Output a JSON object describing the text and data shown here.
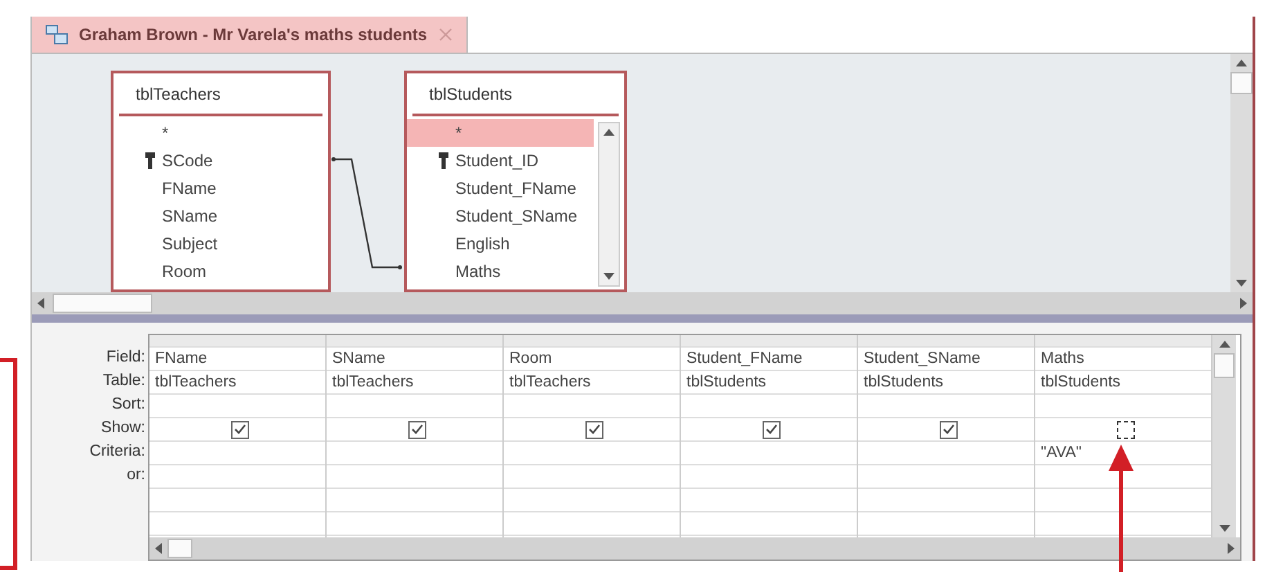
{
  "tab": {
    "title": "Graham Brown - Mr Varela's maths students",
    "selected": true
  },
  "tables": [
    {
      "name": "tblTeachers",
      "scrollable": false,
      "fields": [
        {
          "name": "*",
          "key": false,
          "selected": false
        },
        {
          "name": "SCode",
          "key": true,
          "selected": false
        },
        {
          "name": "FName",
          "key": false,
          "selected": false
        },
        {
          "name": "SName",
          "key": false,
          "selected": false
        },
        {
          "name": "Subject",
          "key": false,
          "selected": false
        },
        {
          "name": "Room",
          "key": false,
          "selected": false
        }
      ]
    },
    {
      "name": "tblStudents",
      "scrollable": true,
      "fields": [
        {
          "name": "*",
          "key": false,
          "selected": true
        },
        {
          "name": "Student_ID",
          "key": true,
          "selected": false
        },
        {
          "name": "Student_FName",
          "key": false,
          "selected": false
        },
        {
          "name": "Student_SName",
          "key": false,
          "selected": false
        },
        {
          "name": "English",
          "key": false,
          "selected": false
        },
        {
          "name": "Maths",
          "key": false,
          "selected": false
        }
      ]
    }
  ],
  "grid": {
    "row_labels": [
      "Field:",
      "Table:",
      "Sort:",
      "Show:",
      "Criteria:",
      "or:"
    ],
    "columns": [
      {
        "field": "FName",
        "table": "tblTeachers",
        "show": true
      },
      {
        "field": "SName",
        "table": "tblTeachers",
        "show": true
      },
      {
        "field": "Room",
        "table": "tblTeachers",
        "show": true
      },
      {
        "field": "Student_FName",
        "table": "tblStudents",
        "show": true
      },
      {
        "field": "Student_SName",
        "table": "tblStudents",
        "show": true
      },
      {
        "field": "Maths",
        "table": "tblStudents",
        "show": false,
        "criteria": "\"AVA\""
      }
    ]
  }
}
